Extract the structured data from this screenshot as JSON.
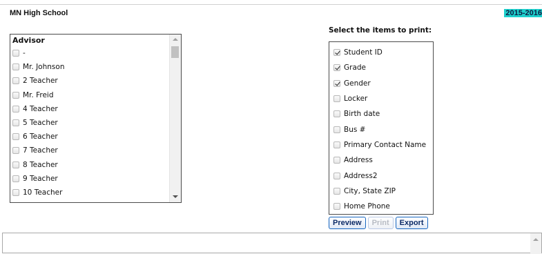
{
  "header": {
    "school": "MN High School",
    "year": "2015-2016"
  },
  "advisor": {
    "title": "Advisor",
    "items": [
      {
        "label": "-",
        "checked": false
      },
      {
        "label": "Mr. Johnson",
        "checked": false
      },
      {
        "label": "2 Teacher",
        "checked": false
      },
      {
        "label": "Mr. Freid",
        "checked": false
      },
      {
        "label": "4 Teacher",
        "checked": false
      },
      {
        "label": "5 Teacher",
        "checked": false
      },
      {
        "label": "6 Teacher",
        "checked": false
      },
      {
        "label": "7 Teacher",
        "checked": false
      },
      {
        "label": "8 Teacher",
        "checked": false
      },
      {
        "label": "9 Teacher",
        "checked": false
      },
      {
        "label": "10 Teacher",
        "checked": false
      }
    ]
  },
  "print_items": {
    "heading": "Select the items to print:",
    "items": [
      {
        "label": "Student ID",
        "checked": true
      },
      {
        "label": "Grade",
        "checked": true
      },
      {
        "label": "Gender",
        "checked": true
      },
      {
        "label": "Locker",
        "checked": false
      },
      {
        "label": "Birth date",
        "checked": false
      },
      {
        "label": "Bus #",
        "checked": false
      },
      {
        "label": "Primary Contact Name",
        "checked": false
      },
      {
        "label": "Address",
        "checked": false
      },
      {
        "label": "Address2",
        "checked": false
      },
      {
        "label": "City, State ZIP",
        "checked": false
      },
      {
        "label": "Home Phone",
        "checked": false
      }
    ]
  },
  "buttons": {
    "preview": "Preview",
    "print": "Print",
    "export": "Export"
  },
  "colors": {
    "year_highlight": "#1ed0cc",
    "button_border": "#1565c0"
  }
}
